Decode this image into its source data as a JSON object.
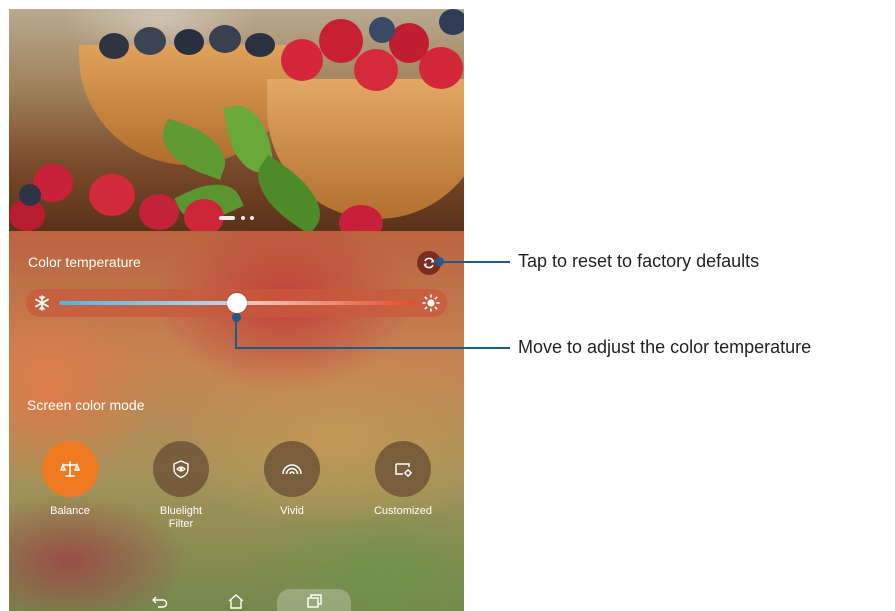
{
  "screen": {
    "color_temperature": {
      "label": "Color temperature",
      "reset_icon": "reset-icon",
      "cold_icon": "snowflake-icon",
      "warm_icon": "sun-icon",
      "slider_value_fraction": 0.5
    },
    "screen_color_mode": {
      "label": "Screen color mode",
      "modes": [
        {
          "label": "Balance",
          "icon": "scale-icon",
          "selected": true
        },
        {
          "label": "Bluelight\nFilter",
          "icon": "eye-shield-icon",
          "selected": false
        },
        {
          "label": "Vivid",
          "icon": "rainbow-icon",
          "selected": false
        },
        {
          "label": "Customized",
          "icon": "screen-settings-icon",
          "selected": false
        }
      ]
    },
    "nav": {
      "back_icon": "back-icon",
      "home_icon": "home-icon",
      "recents_icon": "recent-apps-icon"
    },
    "page_indicator": {
      "count": 3,
      "active": 0
    }
  },
  "callouts": {
    "reset": "Tap to reset to factory defaults",
    "slider": "Move to adjust the color temperature"
  },
  "colors": {
    "accent": "#f07a22",
    "callout": "#1f5a8c",
    "reset_button": "#7d2b21"
  }
}
